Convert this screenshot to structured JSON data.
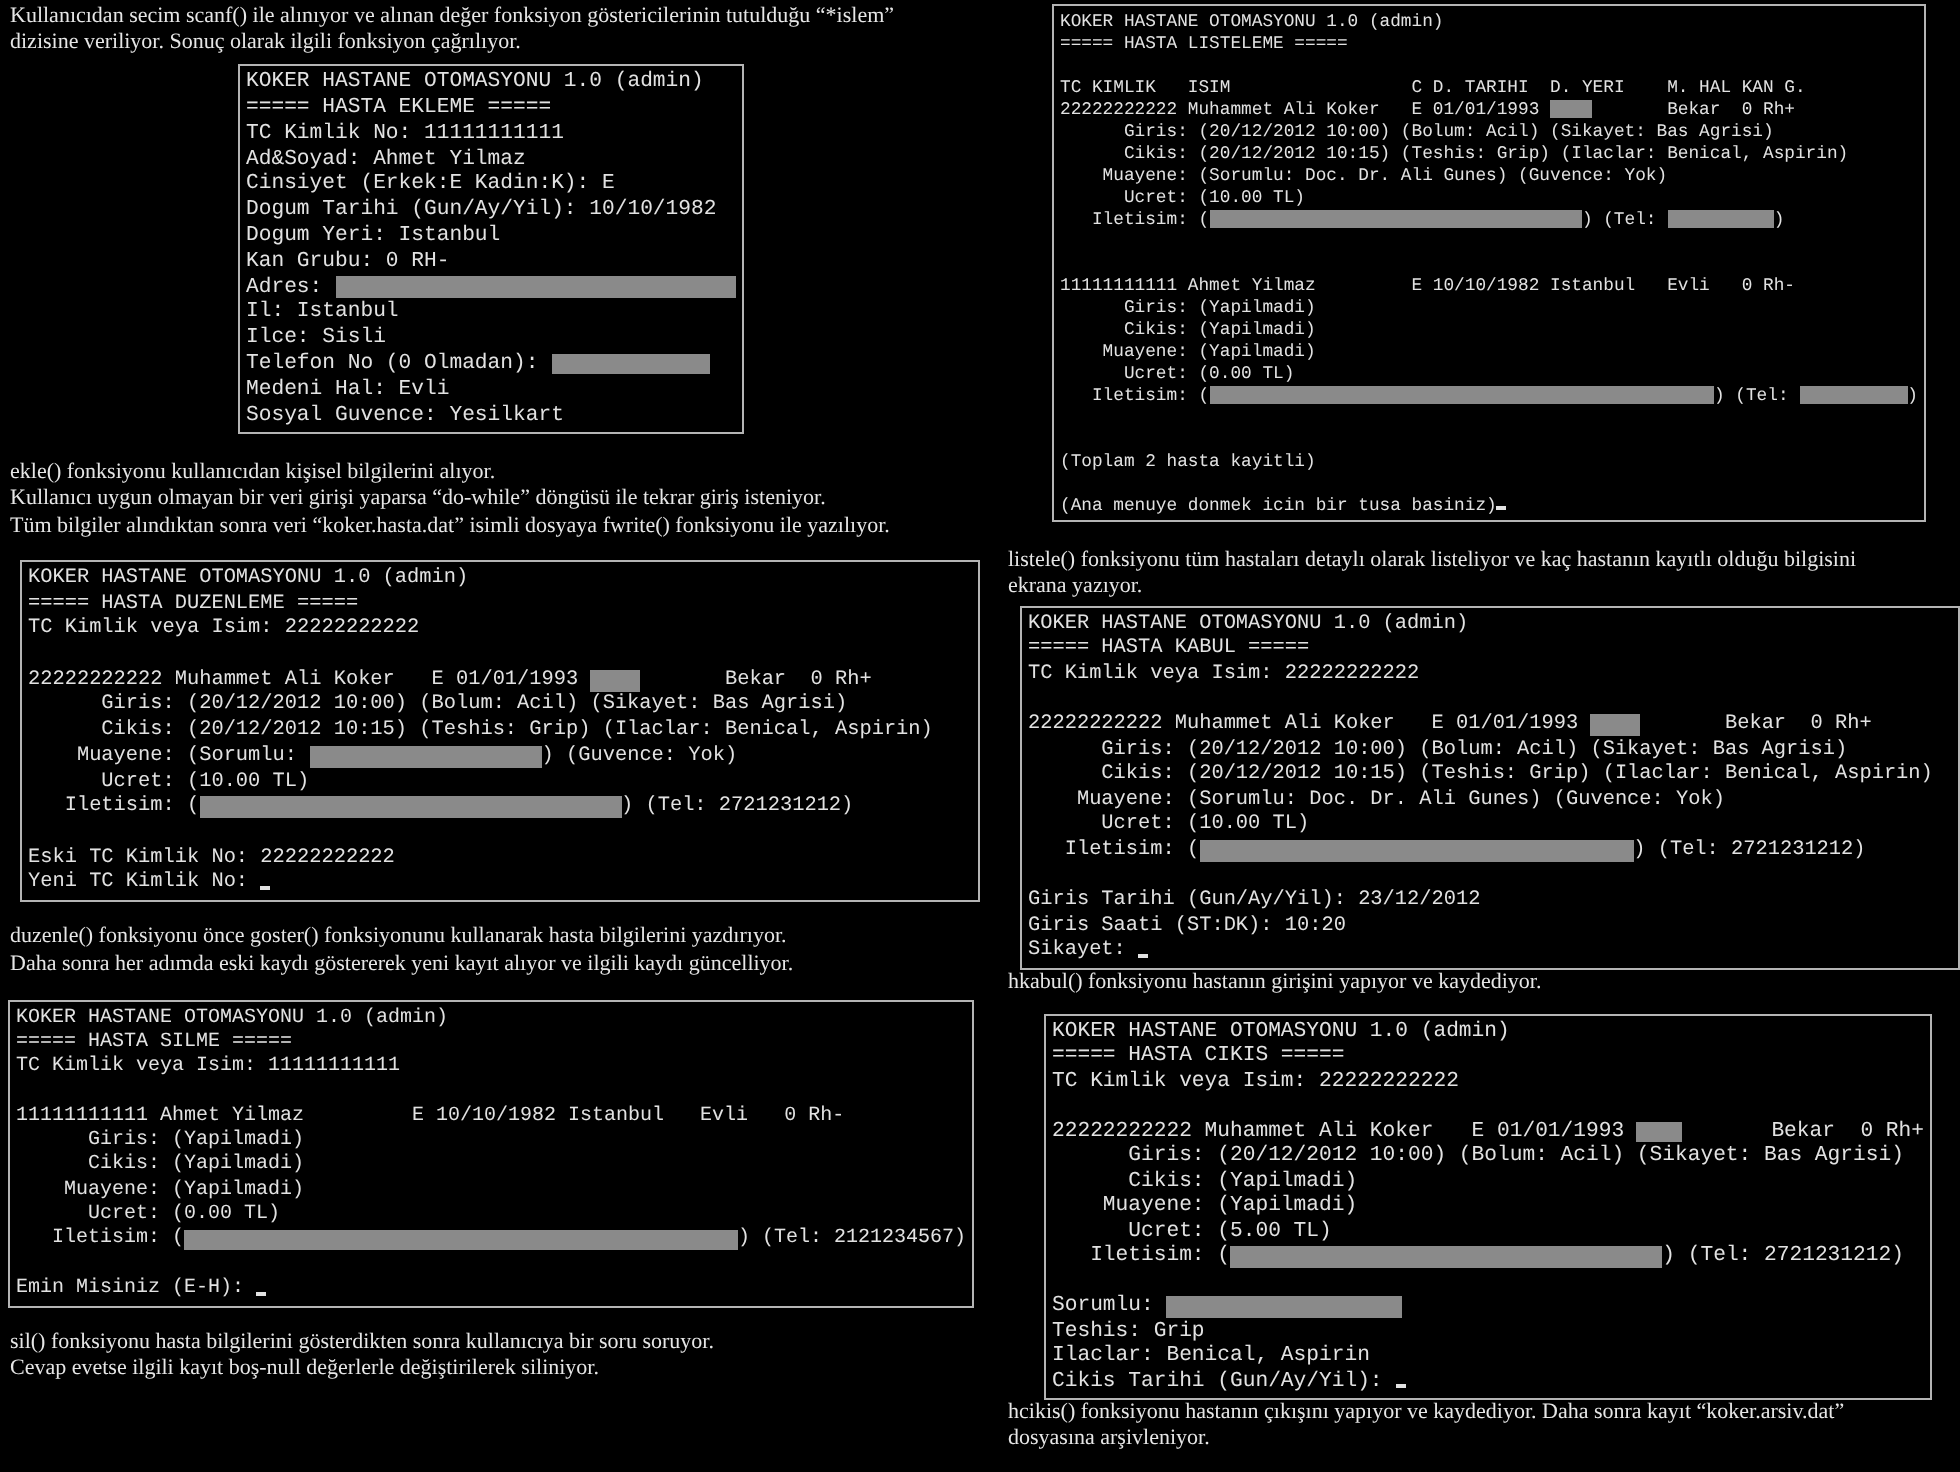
{
  "left": [
    {
      "kind": "caption",
      "lines": [
        "Kullanıcıdan secim scanf() ile alınıyor ve alınan değer fonksiyon göstericilerinin tutulduğu “*islem”",
        "dizisine veriliyor. Sonuç olarak ilgili fonksiyon çağrılıyor."
      ]
    },
    {
      "kind": "terminal",
      "lines": [
        {
          "kind": "text",
          "text": "KOKER HASTANE OTOMASYONU 1.0 (admin)"
        },
        {
          "kind": "text",
          "text": "===== HASTA EKLEME ====="
        },
        {
          "kind": "text",
          "text": "TC Kimlik No: 11111111111"
        },
        {
          "kind": "text",
          "text": "Ad&Soyad: Ahmet Yilmaz"
        },
        {
          "kind": "text",
          "text": "Cinsiyet (Erkek:E Kadin:K): E"
        },
        {
          "kind": "text",
          "text": "Dogum Tarihi (Gun/Ay/Yil): 10/10/1982"
        },
        {
          "kind": "text",
          "text": "Dogum Yeri: Istanbul"
        },
        {
          "kind": "text",
          "text": "Kan Grubu: 0 RH-"
        },
        {
          "kind": "mixed",
          "parts": [
            {
              "kind": "text",
              "text": "Adres: "
            },
            {
              "kind": "redacted"
            }
          ]
        },
        {
          "kind": "text",
          "text": "Il: Istanbul"
        },
        {
          "kind": "text",
          "text": "Ilce: Sisli"
        },
        {
          "kind": "mixed",
          "parts": [
            {
              "kind": "text",
              "text": "Telefon No (0 Olmadan): "
            },
            {
              "kind": "redacted"
            }
          ]
        },
        {
          "kind": "text",
          "text": "Medeni Hal: Evli"
        },
        {
          "kind": "text",
          "text": "Sosyal Guvence: Yesilkart"
        }
      ]
    },
    {
      "kind": "caption",
      "lines": [
        "ekle() fonksiyonu kullanıcıdan kişisel bilgilerini alıyor.",
        "Kullanıcı uygun olmayan bir veri girişi yaparsa “do-while” döngüsü ile tekrar giriş isteniyor.",
        "Tüm bilgiler alındıktan sonra veri “koker.hasta.dat” isimli dosyaya fwrite() fonksiyonu ile yazılıyor."
      ]
    },
    {
      "kind": "terminal",
      "lines": [
        {
          "kind": "text",
          "text": "KOKER HASTANE OTOMASYONU 1.0 (admin)"
        },
        {
          "kind": "text",
          "text": "===== HASTA DUZENLEME ====="
        },
        {
          "kind": "text",
          "text": "TC Kimlik veya Isim: 22222222222"
        },
        {
          "kind": "blank"
        },
        {
          "kind": "mixed",
          "parts": [
            {
              "kind": "text",
              "text": "22222222222 Muhammet Ali Koker   E 01/01/1993 "
            },
            {
              "kind": "redacted"
            },
            {
              "kind": "text",
              "text": "       Bekar  0 Rh+"
            }
          ]
        },
        {
          "kind": "text",
          "text": "      Giris: (20/12/2012 10:00) (Bolum: Acil) (Sikayet: Bas Agrisi)"
        },
        {
          "kind": "text",
          "text": "      Cikis: (20/12/2012 10:15) (Teshis: Grip) (Ilaclar: Benical, Aspirin)"
        },
        {
          "kind": "mixed",
          "parts": [
            {
              "kind": "text",
              "text": "    Muayene: (Sorumlu: "
            },
            {
              "kind": "redacted"
            },
            {
              "kind": "text",
              "text": ") (Guvence: Yok)"
            }
          ]
        },
        {
          "kind": "text",
          "text": "      Ucret: (10.00 TL)"
        },
        {
          "kind": "mixed",
          "parts": [
            {
              "kind": "text",
              "text": "   Iletisim: ("
            },
            {
              "kind": "redacted"
            },
            {
              "kind": "text",
              "text": ") (Tel: 2721231212)"
            }
          ]
        },
        {
          "kind": "blank"
        },
        {
          "kind": "text",
          "text": "Eski TC Kimlik No: 22222222222"
        },
        {
          "kind": "mixed",
          "parts": [
            {
              "kind": "text",
              "text": "Yeni TC Kimlik No: "
            },
            {
              "kind": "cursor"
            }
          ]
        }
      ]
    },
    {
      "kind": "caption",
      "lines": [
        "duzenle() fonksiyonu önce goster() fonksiyonunu kullanarak hasta bilgilerini yazdırıyor.",
        "Daha sonra her adımda eski kaydı göstererek yeni kayıt alıyor ve ilgili kaydı güncelliyor."
      ]
    },
    {
      "kind": "terminal",
      "lines": [
        {
          "kind": "text",
          "text": "KOKER HASTANE OTOMASYONU 1.0 (admin)"
        },
        {
          "kind": "text",
          "text": "===== HASTA SILME ====="
        },
        {
          "kind": "text",
          "text": "TC Kimlik veya Isim: 11111111111"
        },
        {
          "kind": "blank"
        },
        {
          "kind": "text",
          "text": "11111111111 Ahmet Yilmaz         E 10/10/1982 Istanbul   Evli   0 Rh-"
        },
        {
          "kind": "text",
          "text": "      Giris: (Yapilmadi)"
        },
        {
          "kind": "text",
          "text": "      Cikis: (Yapilmadi)"
        },
        {
          "kind": "text",
          "text": "    Muayene: (Yapilmadi)"
        },
        {
          "kind": "text",
          "text": "      Ucret: (0.00 TL)"
        },
        {
          "kind": "mixed",
          "parts": [
            {
              "kind": "text",
              "text": "   Iletisim: ("
            },
            {
              "kind": "redacted"
            },
            {
              "kind": "text",
              "text": ") (Tel: 2121234567)"
            }
          ]
        },
        {
          "kind": "blank"
        },
        {
          "kind": "mixed",
          "parts": [
            {
              "kind": "text",
              "text": "Emin Misiniz (E-H): "
            },
            {
              "kind": "cursor"
            }
          ]
        }
      ]
    },
    {
      "kind": "caption",
      "lines": [
        "sil() fonksiyonu hasta bilgilerini gösterdikten sonra  kullanıcıya bir soru soruyor.",
        "Cevap evetse ilgili kayıt boş-null değerlerle değiştirilerek siliniyor."
      ]
    }
  ],
  "right": [
    {
      "kind": "terminal",
      "lines": [
        {
          "kind": "text",
          "text": "KOKER HASTANE OTOMASYONU 1.0 (admin)"
        },
        {
          "kind": "text",
          "text": "===== HASTA LISTELEME ====="
        },
        {
          "kind": "blank"
        },
        {
          "kind": "text",
          "text": "TC KIMLIK   ISIM                 C D. TARIHI  D. YERI    M. HAL KAN G."
        },
        {
          "kind": "mixed",
          "parts": [
            {
              "kind": "text",
              "text": "22222222222 Muhammet Ali Koker   E 01/01/1993 "
            },
            {
              "kind": "redacted"
            },
            {
              "kind": "text",
              "text": "       Bekar  0 Rh+"
            }
          ]
        },
        {
          "kind": "text",
          "text": "      Giris: (20/12/2012 10:00) (Bolum: Acil) (Sikayet: Bas Agrisi)"
        },
        {
          "kind": "text",
          "text": "      Cikis: (20/12/2012 10:15) (Teshis: Grip) (Ilaclar: Benical, Aspirin)"
        },
        {
          "kind": "text",
          "text": "    Muayene: (Sorumlu: Doc. Dr. Ali Gunes) (Guvence: Yok)"
        },
        {
          "kind": "text",
          "text": "      Ucret: (10.00 TL)"
        },
        {
          "kind": "mixed",
          "parts": [
            {
              "kind": "text",
              "text": "   Iletisim: ("
            },
            {
              "kind": "redacted"
            },
            {
              "kind": "text",
              "text": ") (Tel: "
            },
            {
              "kind": "redacted"
            },
            {
              "kind": "text",
              "text": ")"
            }
          ]
        },
        {
          "kind": "blank"
        },
        {
          "kind": "blank"
        },
        {
          "kind": "text",
          "text": "11111111111 Ahmet Yilmaz         E 10/10/1982 Istanbul   Evli   0 Rh-"
        },
        {
          "kind": "text",
          "text": "      Giris: (Yapilmadi)"
        },
        {
          "kind": "text",
          "text": "      Cikis: (Yapilmadi)"
        },
        {
          "kind": "text",
          "text": "    Muayene: (Yapilmadi)"
        },
        {
          "kind": "text",
          "text": "      Ucret: (0.00 TL)"
        },
        {
          "kind": "mixed",
          "parts": [
            {
              "kind": "text",
              "text": "   Iletisim: ("
            },
            {
              "kind": "redacted"
            },
            {
              "kind": "text",
              "text": ") (Tel: "
            },
            {
              "kind": "redacted"
            },
            {
              "kind": "text",
              "text": ")"
            }
          ]
        },
        {
          "kind": "blank"
        },
        {
          "kind": "blank"
        },
        {
          "kind": "text",
          "text": "(Toplam 2 hasta kayitli)"
        },
        {
          "kind": "blank"
        },
        {
          "kind": "mixed",
          "parts": [
            {
              "kind": "text",
              "text": "(Ana menuye donmek icin bir tusa basiniz)"
            },
            {
              "kind": "cursor"
            }
          ]
        }
      ]
    },
    {
      "kind": "caption",
      "lines": [
        "listele() fonksiyonu tüm hastaları detaylı olarak listeliyor ve kaç hastanın kayıtlı olduğu bilgisini",
        "ekrana yazıyor."
      ]
    },
    {
      "kind": "terminal",
      "lines": [
        {
          "kind": "text",
          "text": "KOKER HASTANE OTOMASYONU 1.0 (admin)"
        },
        {
          "kind": "text",
          "text": "===== HASTA KABUL ====="
        },
        {
          "kind": "text",
          "text": "TC Kimlik veya Isim: 22222222222"
        },
        {
          "kind": "blank"
        },
        {
          "kind": "mixed",
          "parts": [
            {
              "kind": "text",
              "text": "22222222222 Muhammet Ali Koker   E 01/01/1993 "
            },
            {
              "kind": "redacted"
            },
            {
              "kind": "text",
              "text": "       Bekar  0 Rh+"
            }
          ]
        },
        {
          "kind": "text",
          "text": "      Giris: (20/12/2012 10:00) (Bolum: Acil) (Sikayet: Bas Agrisi)"
        },
        {
          "kind": "text",
          "text": "      Cikis: (20/12/2012 10:15) (Teshis: Grip) (Ilaclar: Benical, Aspirin)"
        },
        {
          "kind": "text",
          "text": "    Muayene: (Sorumlu: Doc. Dr. Ali Gunes) (Guvence: Yok)"
        },
        {
          "kind": "text",
          "text": "      Ucret: (10.00 TL)"
        },
        {
          "kind": "mixed",
          "parts": [
            {
              "kind": "text",
              "text": "   Iletisim: ("
            },
            {
              "kind": "redacted"
            },
            {
              "kind": "text",
              "text": ") (Tel: 2721231212)"
            }
          ]
        },
        {
          "kind": "blank"
        },
        {
          "kind": "text",
          "text": "Giris Tarihi (Gun/Ay/Yil): 23/12/2012"
        },
        {
          "kind": "text",
          "text": "Giris Saati (ST:DK): 10:20"
        },
        {
          "kind": "mixed",
          "parts": [
            {
              "kind": "text",
              "text": "Sikayet: "
            },
            {
              "kind": "cursor"
            }
          ]
        }
      ]
    },
    {
      "kind": "caption",
      "lines": [
        "hkabul() fonksiyonu hastanın girişini yapıyor ve kaydediyor."
      ]
    },
    {
      "kind": "terminal",
      "lines": [
        {
          "kind": "text",
          "text": "KOKER HASTANE OTOMASYONU 1.0 (admin)"
        },
        {
          "kind": "text",
          "text": "===== HASTA CIKIS ====="
        },
        {
          "kind": "text",
          "text": "TC Kimlik veya Isim: 22222222222"
        },
        {
          "kind": "blank"
        },
        {
          "kind": "mixed",
          "parts": [
            {
              "kind": "text",
              "text": "22222222222 Muhammet Ali Koker   E 01/01/1993 "
            },
            {
              "kind": "redacted"
            },
            {
              "kind": "text",
              "text": "       Bekar  0 Rh+"
            }
          ]
        },
        {
          "kind": "text",
          "text": "      Giris: (20/12/2012 10:00) (Bolum: Acil) (Sikayet: Bas Agrisi)"
        },
        {
          "kind": "text",
          "text": "      Cikis: (Yapilmadi)"
        },
        {
          "kind": "text",
          "text": "    Muayene: (Yapilmadi)"
        },
        {
          "kind": "text",
          "text": "      Ucret: (5.00 TL)"
        },
        {
          "kind": "mixed",
          "parts": [
            {
              "kind": "text",
              "text": "   Iletisim: ("
            },
            {
              "kind": "redacted"
            },
            {
              "kind": "text",
              "text": ") (Tel: 2721231212)"
            }
          ]
        },
        {
          "kind": "blank"
        },
        {
          "kind": "mixed",
          "parts": [
            {
              "kind": "text",
              "text": "Sorumlu: "
            },
            {
              "kind": "redacted"
            }
          ]
        },
        {
          "kind": "text",
          "text": "Teshis: Grip"
        },
        {
          "kind": "text",
          "text": "Ilaclar: Benical, Aspirin"
        },
        {
          "kind": "mixed",
          "parts": [
            {
              "kind": "text",
              "text": "Cikis Tarihi (Gun/Ay/Yil): "
            },
            {
              "kind": "cursor"
            }
          ]
        }
      ]
    },
    {
      "kind": "caption",
      "lines": [
        "hcikis() fonksiyonu hastanın çıkışını yapıyor ve kaydediyor. Daha sonra kayıt “koker.arsiv.dat”",
        "dosyasına arşivleniyor."
      ]
    }
  ]
}
